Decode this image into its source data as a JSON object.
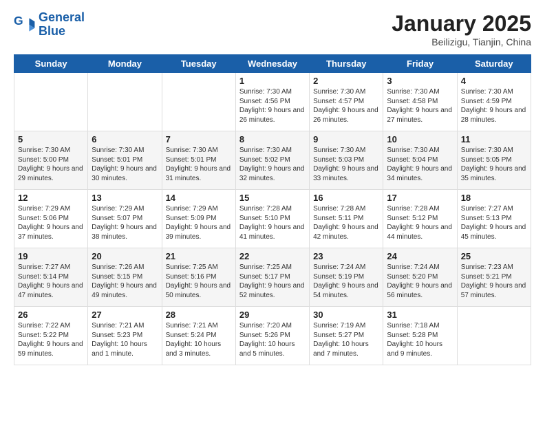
{
  "logo": {
    "line1": "General",
    "line2": "Blue"
  },
  "title": "January 2025",
  "subtitle": "Beilizigu, Tianjin, China",
  "weekdays": [
    "Sunday",
    "Monday",
    "Tuesday",
    "Wednesday",
    "Thursday",
    "Friday",
    "Saturday"
  ],
  "weeks": [
    [
      {
        "day": "",
        "text": ""
      },
      {
        "day": "",
        "text": ""
      },
      {
        "day": "",
        "text": ""
      },
      {
        "day": "1",
        "text": "Sunrise: 7:30 AM\nSunset: 4:56 PM\nDaylight: 9 hours and 26 minutes."
      },
      {
        "day": "2",
        "text": "Sunrise: 7:30 AM\nSunset: 4:57 PM\nDaylight: 9 hours and 26 minutes."
      },
      {
        "day": "3",
        "text": "Sunrise: 7:30 AM\nSunset: 4:58 PM\nDaylight: 9 hours and 27 minutes."
      },
      {
        "day": "4",
        "text": "Sunrise: 7:30 AM\nSunset: 4:59 PM\nDaylight: 9 hours and 28 minutes."
      }
    ],
    [
      {
        "day": "5",
        "text": "Sunrise: 7:30 AM\nSunset: 5:00 PM\nDaylight: 9 hours and 29 minutes."
      },
      {
        "day": "6",
        "text": "Sunrise: 7:30 AM\nSunset: 5:01 PM\nDaylight: 9 hours and 30 minutes."
      },
      {
        "day": "7",
        "text": "Sunrise: 7:30 AM\nSunset: 5:01 PM\nDaylight: 9 hours and 31 minutes."
      },
      {
        "day": "8",
        "text": "Sunrise: 7:30 AM\nSunset: 5:02 PM\nDaylight: 9 hours and 32 minutes."
      },
      {
        "day": "9",
        "text": "Sunrise: 7:30 AM\nSunset: 5:03 PM\nDaylight: 9 hours and 33 minutes."
      },
      {
        "day": "10",
        "text": "Sunrise: 7:30 AM\nSunset: 5:04 PM\nDaylight: 9 hours and 34 minutes."
      },
      {
        "day": "11",
        "text": "Sunrise: 7:30 AM\nSunset: 5:05 PM\nDaylight: 9 hours and 35 minutes."
      }
    ],
    [
      {
        "day": "12",
        "text": "Sunrise: 7:29 AM\nSunset: 5:06 PM\nDaylight: 9 hours and 37 minutes."
      },
      {
        "day": "13",
        "text": "Sunrise: 7:29 AM\nSunset: 5:07 PM\nDaylight: 9 hours and 38 minutes."
      },
      {
        "day": "14",
        "text": "Sunrise: 7:29 AM\nSunset: 5:09 PM\nDaylight: 9 hours and 39 minutes."
      },
      {
        "day": "15",
        "text": "Sunrise: 7:28 AM\nSunset: 5:10 PM\nDaylight: 9 hours and 41 minutes."
      },
      {
        "day": "16",
        "text": "Sunrise: 7:28 AM\nSunset: 5:11 PM\nDaylight: 9 hours and 42 minutes."
      },
      {
        "day": "17",
        "text": "Sunrise: 7:28 AM\nSunset: 5:12 PM\nDaylight: 9 hours and 44 minutes."
      },
      {
        "day": "18",
        "text": "Sunrise: 7:27 AM\nSunset: 5:13 PM\nDaylight: 9 hours and 45 minutes."
      }
    ],
    [
      {
        "day": "19",
        "text": "Sunrise: 7:27 AM\nSunset: 5:14 PM\nDaylight: 9 hours and 47 minutes."
      },
      {
        "day": "20",
        "text": "Sunrise: 7:26 AM\nSunset: 5:15 PM\nDaylight: 9 hours and 49 minutes."
      },
      {
        "day": "21",
        "text": "Sunrise: 7:25 AM\nSunset: 5:16 PM\nDaylight: 9 hours and 50 minutes."
      },
      {
        "day": "22",
        "text": "Sunrise: 7:25 AM\nSunset: 5:17 PM\nDaylight: 9 hours and 52 minutes."
      },
      {
        "day": "23",
        "text": "Sunrise: 7:24 AM\nSunset: 5:19 PM\nDaylight: 9 hours and 54 minutes."
      },
      {
        "day": "24",
        "text": "Sunrise: 7:24 AM\nSunset: 5:20 PM\nDaylight: 9 hours and 56 minutes."
      },
      {
        "day": "25",
        "text": "Sunrise: 7:23 AM\nSunset: 5:21 PM\nDaylight: 9 hours and 57 minutes."
      }
    ],
    [
      {
        "day": "26",
        "text": "Sunrise: 7:22 AM\nSunset: 5:22 PM\nDaylight: 9 hours and 59 minutes."
      },
      {
        "day": "27",
        "text": "Sunrise: 7:21 AM\nSunset: 5:23 PM\nDaylight: 10 hours and 1 minute."
      },
      {
        "day": "28",
        "text": "Sunrise: 7:21 AM\nSunset: 5:24 PM\nDaylight: 10 hours and 3 minutes."
      },
      {
        "day": "29",
        "text": "Sunrise: 7:20 AM\nSunset: 5:26 PM\nDaylight: 10 hours and 5 minutes."
      },
      {
        "day": "30",
        "text": "Sunrise: 7:19 AM\nSunset: 5:27 PM\nDaylight: 10 hours and 7 minutes."
      },
      {
        "day": "31",
        "text": "Sunrise: 7:18 AM\nSunset: 5:28 PM\nDaylight: 10 hours and 9 minutes."
      },
      {
        "day": "",
        "text": ""
      }
    ]
  ]
}
